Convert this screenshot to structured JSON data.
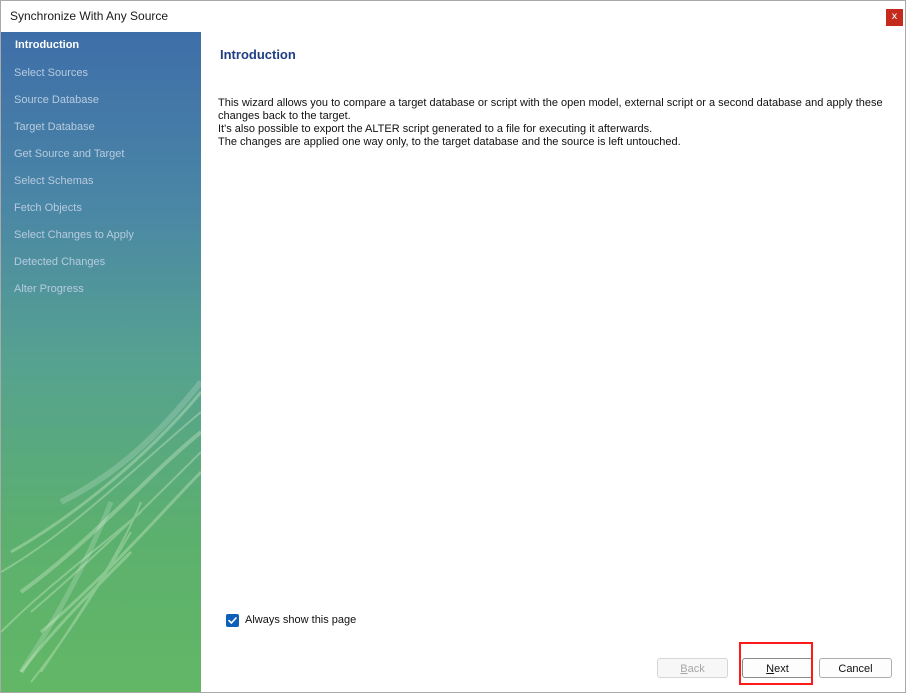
{
  "window": {
    "title": "Synchronize With Any Source",
    "close_glyph": "x",
    "close_icon": "close-icon",
    "close_color": "#c42b1c"
  },
  "sidebar": {
    "items": [
      {
        "label": "Introduction",
        "active": true
      },
      {
        "label": "Select Sources",
        "active": false
      },
      {
        "label": "Source Database",
        "active": false
      },
      {
        "label": "Target Database",
        "active": false
      },
      {
        "label": "Get Source and Target",
        "active": false
      },
      {
        "label": "Select Schemas",
        "active": false
      },
      {
        "label": "Fetch Objects",
        "active": false
      },
      {
        "label": "Select Changes to Apply",
        "active": false
      },
      {
        "label": "Detected Changes",
        "active": false
      },
      {
        "label": "Alter Progress",
        "active": false
      }
    ],
    "colors": {
      "top": "#3e6ea8",
      "bottom": "#62b766"
    }
  },
  "main": {
    "title": "Introduction",
    "title_color": "#1f3f83",
    "description": [
      "This wizard allows you to compare a target database or script with the open model, external script or a second database and apply these",
      "changes back to the target.",
      "It's also possible to export the ALTER script generated to a file for executing it afterwards.",
      "The changes are applied one way only, to the target database and the source is left untouched."
    ],
    "always_show": {
      "label": "Always show this page",
      "checked": true,
      "icon": "check-icon"
    }
  },
  "footer": {
    "back": {
      "label_first": "B",
      "label_rest": "ack",
      "enabled": false
    },
    "next": {
      "label_first": "N",
      "label_rest": "ext",
      "enabled": true
    },
    "cancel": {
      "label": "Cancel",
      "enabled": true
    }
  },
  "highlight_color": "#ff1a1a"
}
